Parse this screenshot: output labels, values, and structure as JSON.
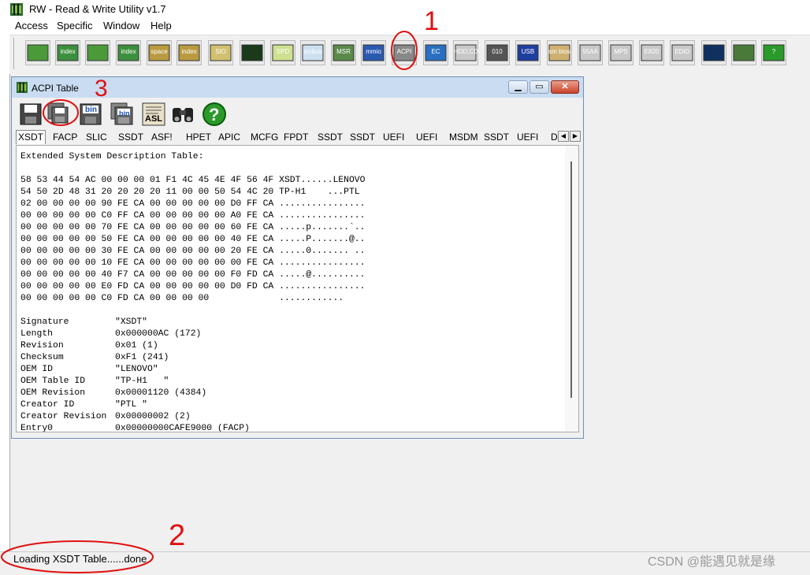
{
  "app": {
    "title": "RW - Read & Write Utility v1.7",
    "menu": [
      "Access",
      "Specific",
      "Window",
      "Help"
    ]
  },
  "toolbar": {
    "buttons": [
      {
        "label": ""
      },
      {
        "label": "index"
      },
      {
        "label": ""
      },
      {
        "label": "index"
      },
      {
        "label": "space"
      },
      {
        "label": "index"
      },
      {
        "label": "SIO"
      },
      {
        "label": ""
      },
      {
        "label": "SPD"
      },
      {
        "label": "smbus"
      },
      {
        "label": "MSR"
      },
      {
        "label": "mmio"
      },
      {
        "label": "ACPI"
      },
      {
        "label": "EC"
      },
      {
        "label": "HDD,CD"
      },
      {
        "label": "010"
      },
      {
        "label": "USB"
      },
      {
        "label": "sm bios"
      },
      {
        "label": "55AA"
      },
      {
        "label": "MPS"
      },
      {
        "label": "E820"
      },
      {
        "label": "EDID"
      },
      {
        "label": ""
      },
      {
        "label": ""
      },
      {
        "label": "?"
      }
    ]
  },
  "acpi_window": {
    "title": "ACPI Table",
    "tools": [
      "save-icon",
      "save-all-icon",
      "save-bin-icon",
      "save-all-bin-icon",
      "asl-icon",
      "binoculars-icon",
      "help-icon"
    ],
    "tool_labels": {
      "bin1": "bin",
      "bin2": "bin",
      "asl": "ASL",
      "help": "?"
    },
    "tabs": [
      "XSDT",
      "FACP",
      "SLIC",
      "SSDT",
      "ASF!",
      "HPET",
      "APIC",
      "MCFG",
      "FPDT",
      "SSDT",
      "SSDT",
      "UEFI",
      "UEFI",
      "MSDM",
      "SSDT",
      "UEFI",
      "D"
    ],
    "heading": "Extended System Description Table:",
    "hex_lines": [
      "58 53 44 54 AC 00 00 00 01 F1 4C 45 4E 4F 56 4F XSDT......LENOVO",
      "54 50 2D 48 31 20 20 20 20 11 00 00 50 54 4C 20 TP-H1    ...PTL",
      "02 00 00 00 00 90 FE CA 00 00 00 00 00 D0 FF CA ................",
      "00 00 00 00 00 C0 FF CA 00 00 00 00 00 A0 FE CA ................",
      "00 00 00 00 00 70 FE CA 00 00 00 00 00 60 FE CA .....p.......`..",
      "00 00 00 00 00 50 FE CA 00 00 00 00 00 40 FE CA .....P.......@..",
      "00 00 00 00 00 30 FE CA 00 00 00 00 00 20 FE CA .....0....... ..",
      "00 00 00 00 00 10 FE CA 00 00 00 00 00 00 FE CA ................",
      "00 00 00 00 00 40 F7 CA 00 00 00 00 00 F0 FD CA .....@..........",
      "00 00 00 00 00 E0 FD CA 00 00 00 00 00 D0 FD CA ................",
      "00 00 00 00 00 C0 FD CA 00 00 00 00             ............"
    ],
    "fields": [
      {
        "label": "Signature",
        "value": "\"XSDT\""
      },
      {
        "label": "Length",
        "value": "0x000000AC (172)"
      },
      {
        "label": "Revision",
        "value": "0x01 (1)"
      },
      {
        "label": "Checksum",
        "value": "0xF1 (241)"
      },
      {
        "label": "OEM ID",
        "value": "\"LENOVO\""
      },
      {
        "label": "OEM Table ID",
        "value": "\"TP-H1   \""
      },
      {
        "label": "OEM Revision",
        "value": "0x00001120 (4384)"
      },
      {
        "label": "Creator ID",
        "value": "\"PTL \""
      },
      {
        "label": "Creator Revision",
        "value": "0x00000002 (2)"
      },
      {
        "label": "Entry0",
        "value": "0x00000000CAFE9000 (FACP)"
      }
    ]
  },
  "status": {
    "text": "Loading XSDT Table......done"
  },
  "annotations": {
    "one": "1",
    "two": "2",
    "three": "3"
  },
  "watermark": "CSDN @能遇见就是缘"
}
